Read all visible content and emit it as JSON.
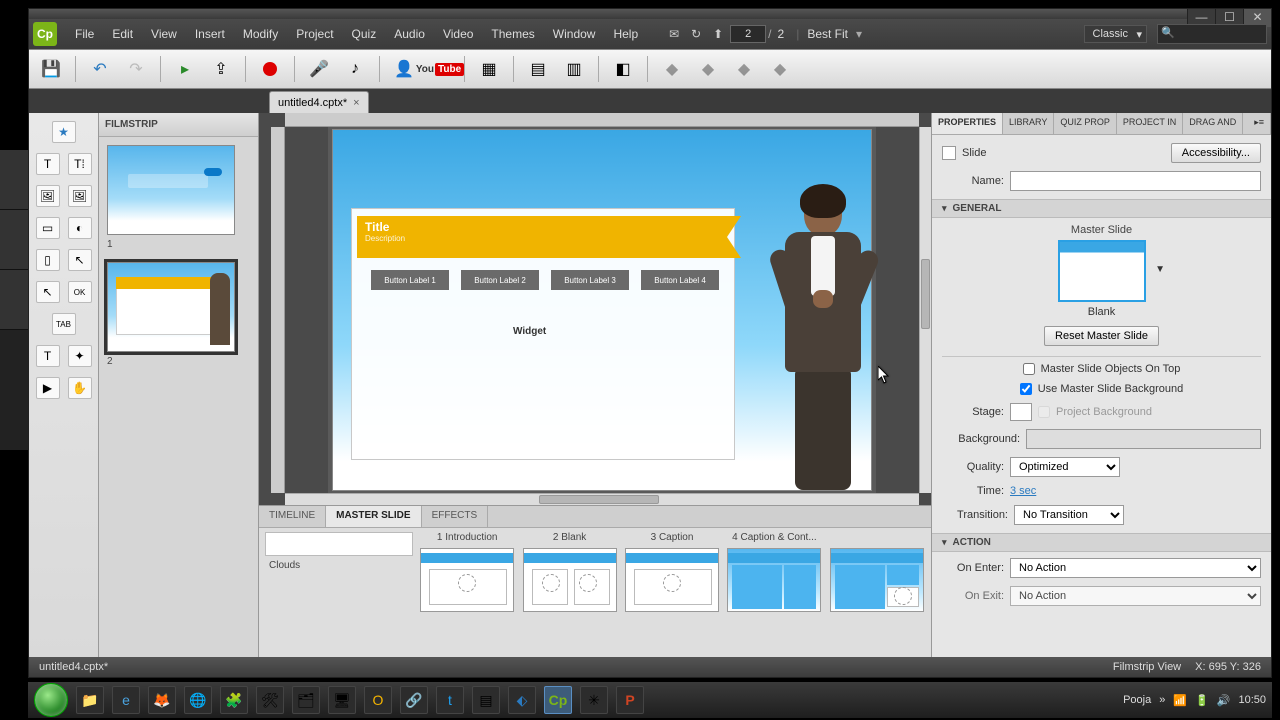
{
  "menus": [
    "File",
    "Edit",
    "View",
    "Insert",
    "Modify",
    "Project",
    "Quiz",
    "Audio",
    "Video",
    "Themes",
    "Window",
    "Help"
  ],
  "page": {
    "current": "2",
    "sep": "/",
    "total": "2"
  },
  "zoom": "Best Fit",
  "workspace": "Classic",
  "doc_tab": "untitled4.cptx*",
  "filmstrip": {
    "title": "FILMSTRIP",
    "slides": [
      {
        "num": "1"
      },
      {
        "num": "2"
      }
    ]
  },
  "slide_content": {
    "title": "Title",
    "subtitle": "Description",
    "buttons": [
      "Button Label 1",
      "Button Label 2",
      "Button Label 3",
      "Button Label 4"
    ],
    "widget": "Widget"
  },
  "bottom_tabs": [
    "TIMELINE",
    "MASTER SLIDE",
    "EFFECTS"
  ],
  "master_group": "Clouds",
  "master_items": [
    "1 Introduction",
    "2 Blank",
    "3 Caption",
    "4 Caption & Cont..."
  ],
  "right_tabs": [
    "PROPERTIES",
    "LIBRARY",
    "QUIZ PROP",
    "PROJECT IN",
    "DRAG AND"
  ],
  "props": {
    "type": "Slide",
    "accessibility": "Accessibility...",
    "name_label": "Name:",
    "general": "GENERAL",
    "master_slide_label": "Master Slide",
    "master_name": "Blank",
    "reset": "Reset Master Slide",
    "objects_on_top": "Master Slide Objects On Top",
    "use_bg": "Use Master Slide Background",
    "stage": "Stage:",
    "proj_bg": "Project Background",
    "background": "Background:",
    "quality_label": "Quality:",
    "quality": "Optimized",
    "time_label": "Time:",
    "time_value": "3 sec",
    "transition_label": "Transition:",
    "transition": "No Transition",
    "action": "ACTION",
    "on_enter_label": "On Enter:",
    "on_enter": "No Action",
    "on_exit_label": "On Exit:",
    "on_exit": "No Action"
  },
  "status": {
    "file": "untitled4.cptx*",
    "view": "Filmstrip View",
    "coords": "X: 695 Y: 326"
  },
  "tray": {
    "user": "Pooja",
    "time": "10:50"
  }
}
